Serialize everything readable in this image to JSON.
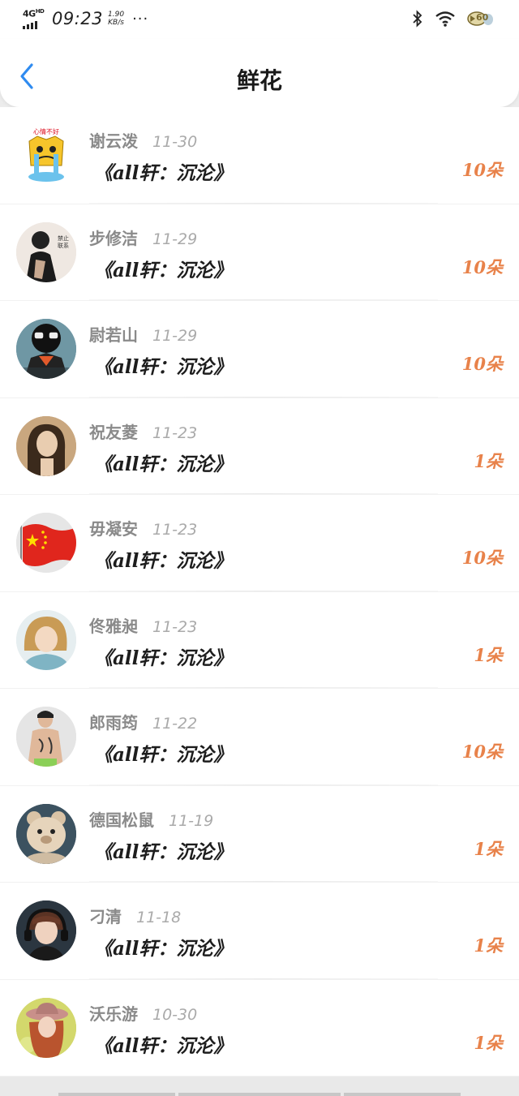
{
  "status_bar": {
    "network": "4G",
    "network_sup": "HD",
    "time": "09:23",
    "speed_value": "1.90",
    "speed_unit": "KB/s",
    "more": "···",
    "battery": "60"
  },
  "header": {
    "title": "鲜花"
  },
  "gifts": [
    {
      "name": "谢云泼",
      "date": "11-30",
      "book": "《all轩：沉沦》",
      "count": "10朵",
      "avatar": "avatar-sad-cartoon"
    },
    {
      "name": "步修洁",
      "date": "11-29",
      "book": "《all轩：沉沦》",
      "count": "10朵",
      "avatar": "avatar-masked-figure"
    },
    {
      "name": "尉若山",
      "date": "11-29",
      "book": "《all轩：沉沦》",
      "count": "10朵",
      "avatar": "avatar-sunglasses-girl"
    },
    {
      "name": "祝友菱",
      "date": "11-23",
      "book": "《all轩：沉沦》",
      "count": "1朵",
      "avatar": "avatar-sepia-girl"
    },
    {
      "name": "毋凝安",
      "date": "11-23",
      "book": "《all轩：沉沦》",
      "count": "10朵",
      "avatar": "avatar-flag"
    },
    {
      "name": "佟雅昶",
      "date": "11-23",
      "book": "《all轩：沉沦》",
      "count": "1朵",
      "avatar": "avatar-blonde-girl"
    },
    {
      "name": "郎雨筠",
      "date": "11-22",
      "book": "《all轩：沉沦》",
      "count": "10朵",
      "avatar": "avatar-tattoo-man"
    },
    {
      "name": "德国松鼠",
      "date": "11-19",
      "book": "《all轩：沉沦》",
      "count": "1朵",
      "avatar": "avatar-plush-bear"
    },
    {
      "name": "刁清",
      "date": "11-18",
      "book": "《all轩：沉沦》",
      "count": "1朵",
      "avatar": "avatar-headphone-boy"
    },
    {
      "name": "沃乐游",
      "date": "10-30",
      "book": "《all轩：沉沦》",
      "count": "1朵",
      "avatar": "avatar-hat-girl"
    }
  ],
  "colors": {
    "accent_blue": "#2f8bf0",
    "count_orange": "#e8824a",
    "name_gray": "#8a8a8a"
  }
}
